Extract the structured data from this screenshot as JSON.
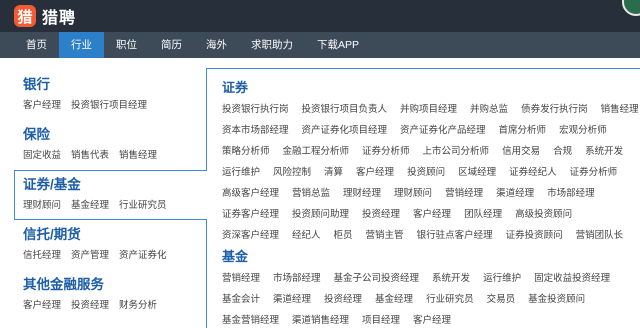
{
  "header": {
    "logo_icon": "猎",
    "logo_text": "猎聘"
  },
  "nav": {
    "items": [
      {
        "label": "首页",
        "active": false
      },
      {
        "label": "行业",
        "active": true
      },
      {
        "label": "职位",
        "active": false
      },
      {
        "label": "简历",
        "active": false
      },
      {
        "label": "海外",
        "active": false
      },
      {
        "label": "求职助力",
        "active": false
      },
      {
        "label": "下载APP",
        "active": false
      }
    ]
  },
  "categories": [
    {
      "title": "银行",
      "subs": [
        "客户经理",
        "投资银行项目经理"
      ]
    },
    {
      "title": "保险",
      "subs": [
        "固定收益",
        "销售代表",
        "销售经理"
      ]
    },
    {
      "title": "证券/基金",
      "subs": [
        "理财顾问",
        "基金经理",
        "行业研究员"
      ]
    },
    {
      "title": "信托/期货",
      "subs": [
        "信托经理",
        "资产管理",
        "资产证券化"
      ]
    },
    {
      "title": "其他金融服务",
      "subs": [
        "客户经理",
        "投资经理",
        "财务分析"
      ]
    }
  ],
  "sections": [
    {
      "title": "证券",
      "jobs": [
        "投资银行执行岗",
        "投资银行项目负责人",
        "并购项目经理",
        "并购总监",
        "债券发行执行岗",
        "销售经理",
        "资本市场部经理",
        "资产证券化项目经理",
        "资产证券化产品经理",
        "首席分析师",
        "宏观分析师",
        "策略分析师",
        "金融工程分析师",
        "证券分析师",
        "上市公司分析师",
        "信用交易",
        "合规",
        "系统开发",
        "运行维护",
        "风险控制",
        "清算",
        "客户经理",
        "投资顾问",
        "区域经理",
        "证券经纪人",
        "证券分析师",
        "高级客户经理",
        "营销总监",
        "理财经理",
        "理财顾问",
        "营销经理",
        "渠道经理",
        "市场部经理",
        "证券客户经理",
        "投资顾问助理",
        "投资经理",
        "客户经理",
        "团队经理",
        "高级投资顾问",
        "资深客户经理",
        "经纪人",
        "柜员",
        "营销主管",
        "银行驻点客户经理",
        "证券投资顾问",
        "营销团队长"
      ]
    },
    {
      "title": "基金",
      "jobs": [
        "营销经理",
        "市场部经理",
        "基金子公司投资经理",
        "系统开发",
        "运行维护",
        "固定收益投资经理",
        "基金会计",
        "渠道经理",
        "投资经理",
        "基金经理",
        "行业研究员",
        "交易员",
        "基金投资顾问",
        "基金营销经理",
        "渠道销售经理",
        "项目经理",
        "客户经理"
      ]
    }
  ],
  "colors": {
    "topbar": "#27303a",
    "navbar": "#3d4a58",
    "nav_active": "#2c80c9",
    "title_blue": "#1d5ea8",
    "logo_orange": "#f45b33",
    "border_blue": "#3e8ad3"
  }
}
